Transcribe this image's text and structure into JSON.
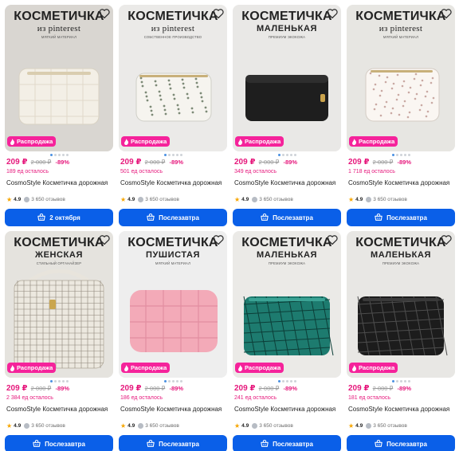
{
  "common": {
    "sale_label": "Распродажа",
    "product_title": "CosmoStyle Косметичка дорожная",
    "rating": "4.9",
    "reviews": "3 650 отзывов",
    "old_price": "2 000 ₽",
    "discount": "-89%",
    "price": "209 ₽"
  },
  "colors": {
    "accent_pink": "#e6187c",
    "badge_pink": "#f5239b",
    "button_blue": "#0a5fe8",
    "star": "#f7a600"
  },
  "products": [
    {
      "poster_title": "КОСМЕТИЧКА",
      "poster_sub": "из pinterest",
      "poster_note": "МЯГКИЙ МАТЕРИАЛ",
      "price": "209 ₽",
      "old_price": "2 000 ₽",
      "discount": "-89%",
      "stock": "189 ед осталось",
      "delivery": "2 октября",
      "bag": "cream-quilted"
    },
    {
      "poster_title": "КОСМЕТИЧКА",
      "poster_sub": "из pinterest",
      "poster_note": "СОБСТВЕННОЕ ПРОИЗВОДСТВО",
      "price": "209 ₽",
      "old_price": "2 000 ₽",
      "discount": "-89%",
      "stock": "501 ед осталось",
      "delivery": "Послезавтра",
      "bag": "floral"
    },
    {
      "poster_title": "КОСМЕТИЧКА",
      "poster_sub": "МАЛЕНЬКАЯ",
      "poster_note": "ПРЕМИУМ ЭКОКОЖА",
      "price": "209 ₽",
      "old_price": "2 000 ₽",
      "discount": "-89%",
      "stock": "349 ед осталось",
      "delivery": "Послезавтра",
      "bag": "black-leather"
    },
    {
      "poster_title": "КОСМЕТИЧКА",
      "poster_sub": "из pinterest",
      "poster_note": "МЯГКИЙ МАТЕРИАЛ",
      "price": "209 ₽",
      "old_price": "2 000 ₽",
      "discount": "-89%",
      "stock": "1 718 ед осталось",
      "delivery": "Послезавтра",
      "bag": "floral-light"
    },
    {
      "poster_title": "КОСМЕТИЧКА",
      "poster_sub": "ЖЕНСКАЯ",
      "poster_note": "СТИЛЬНЫЙ ОРГАНАЙЗЕР",
      "price": "209 ₽",
      "old_price": "2 000 ₽",
      "discount": "-89%",
      "stock": "2 384 ед осталось",
      "delivery": "Послезавтра",
      "bag": "tweed"
    },
    {
      "poster_title": "КОСМЕТИЧКА",
      "poster_sub": "ПУШИСТАЯ",
      "poster_note": "МЯГКИЙ МАТЕРИАЛ",
      "price": "209 ₽",
      "old_price": "2 000 ₽",
      "discount": "-89%",
      "stock": "186 ед осталось",
      "delivery": "Послезавтра",
      "bag": "pink-quilted"
    },
    {
      "poster_title": "КОСМЕТИЧКА",
      "poster_sub": "МАЛЕНЬКАЯ",
      "poster_note": "ПРЕМИУМ ЭКОКОЖА",
      "price": "209 ₽",
      "old_price": "2 000 ₽",
      "discount": "-89%",
      "stock": "241 ед осталось",
      "delivery": "Послезавтра",
      "bag": "green-geo"
    },
    {
      "poster_title": "КОСМЕТИЧКА",
      "poster_sub": "МАЛЕНЬКАЯ",
      "poster_note": "ПРЕМИУМ ЭКОКОЖА",
      "price": "209 ₽",
      "old_price": "2 000 ₽",
      "discount": "-89%",
      "stock": "181 ед осталось",
      "delivery": "Послезавтра",
      "bag": "black-geo"
    }
  ]
}
